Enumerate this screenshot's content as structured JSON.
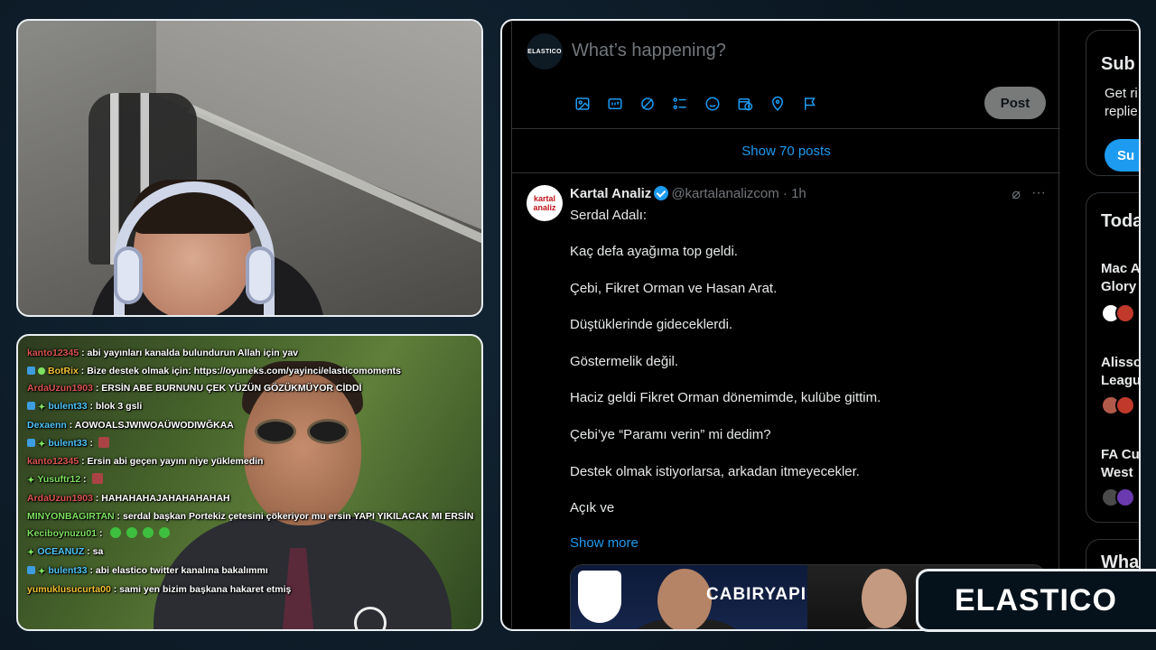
{
  "chat": {
    "messages": [
      {
        "user": "kanto12345",
        "color": "#d9534f",
        "text": "abi yayınları kanalda bulundurun Allah için yav",
        "badges": []
      },
      {
        "user": "BotRix",
        "color": "#f1c232",
        "text": "Bize destek olmak için: https://oyuneks.com/yayinci/elasticomoments",
        "badges": [
          "mod",
          "sub"
        ],
        "wrap": true
      },
      {
        "user": "ArdaUzun1903",
        "color": "#d9534f",
        "text": "ERSİN ABE BURNUNU ÇEK YÜZÜN GÖZÜKMÜYOR CİDDİ",
        "badges": []
      },
      {
        "user": "bulent33",
        "color": "#4fc3f7",
        "text": "blok 3 gsli",
        "badges": [
          "mod",
          "star"
        ]
      },
      {
        "user": "Dexaenn",
        "color": "#4fc3f7",
        "text": "AOWOALSJWIWOAÜWODIWĞKAA",
        "badges": []
      },
      {
        "user": "bulent33",
        "color": "#4fc3f7",
        "text": "",
        "badges": [
          "mod",
          "star"
        ],
        "emote": "red"
      },
      {
        "user": "kanto12345",
        "color": "#d9534f",
        "text": "Ersin abi geçen yayını niye yüklemedin",
        "badges": []
      },
      {
        "user": "Yusuftr12",
        "color": "#7ee05f",
        "text": "",
        "badges": [
          "star"
        ],
        "emote": "red"
      },
      {
        "user": "ArdaUzun1903",
        "color": "#d9534f",
        "text": "HAHAHAHAJAHAHAHAHAH",
        "badges": []
      },
      {
        "user": "MINYONBAGIRTAN",
        "color": "#7ee05f",
        "text": "serdal başkan Portekiz çetesini çökeriyor mu ersin YAPI YIKILACAK MI ERSİN",
        "badges": [],
        "wrap": true
      },
      {
        "user": "Keciboynuzu01",
        "color": "#7ee05f",
        "text": "",
        "badges": [],
        "emote": "green4"
      },
      {
        "user": "OCEANUZ",
        "color": "#4fc3f7",
        "text": "sa",
        "badges": [
          "star"
        ]
      },
      {
        "user": "bulent33",
        "color": "#4fc3f7",
        "text": "abi elastico twitter kanalına bakalımmı",
        "badges": [
          "mod",
          "star"
        ]
      },
      {
        "user": "yumuklusucurta00",
        "color": "#f1c232",
        "text": "sami yen bizim başkana hakaret etmiş",
        "badges": []
      }
    ]
  },
  "compose": {
    "avatar_text": "ELASTICO",
    "placeholder": "What’s happening?",
    "post_label": "Post",
    "tools": [
      "image-icon",
      "gif-icon",
      "grok-icon",
      "poll-icon",
      "emoji-icon",
      "schedule-icon",
      "location-icon",
      "flag-icon"
    ]
  },
  "feed": {
    "show_posts": "Show 70 posts"
  },
  "tweet": {
    "avatar_text_1": "kartal",
    "avatar_text_2": "analiz",
    "name": "Kartal Analiz",
    "handle": "@kartalanalizcom · 1h",
    "lines": [
      "Serdal Adalı:",
      "Kaç defa ayağıma top geldi.",
      "Çebi, Fikret Orman ve Hasan Arat.",
      "Düştüklerinde gideceklerdi.",
      "Göstermelik değil.",
      "Haciz geldi Fikret Orman dönemimde, kulübe gittim.",
      "Çebi’ye “Paramı verin” mi dedim?",
      "Destek olmak istiyorlarsa, arkadan itmeyecekler.",
      "Açık ve"
    ],
    "show_more": "Show more",
    "media_text": "CABIRYAPI"
  },
  "sidebar": {
    "subscribe_title": "Sub",
    "subscribe_text_1": "Get ri",
    "subscribe_text_2": "replie",
    "subscribe_btn": "Su",
    "today_title": "Toda",
    "trends": [
      {
        "line1": "Mac A",
        "line2": "Glory"
      },
      {
        "line1": "Alisso",
        "line2": "League"
      },
      {
        "line1": "FA Cu",
        "line2": "West"
      }
    ],
    "what_title": "Wha"
  },
  "logo": {
    "text": "ELASTICO"
  },
  "colors": {
    "twitter_blue": "#1d9bf0",
    "border": "#2f3336"
  }
}
